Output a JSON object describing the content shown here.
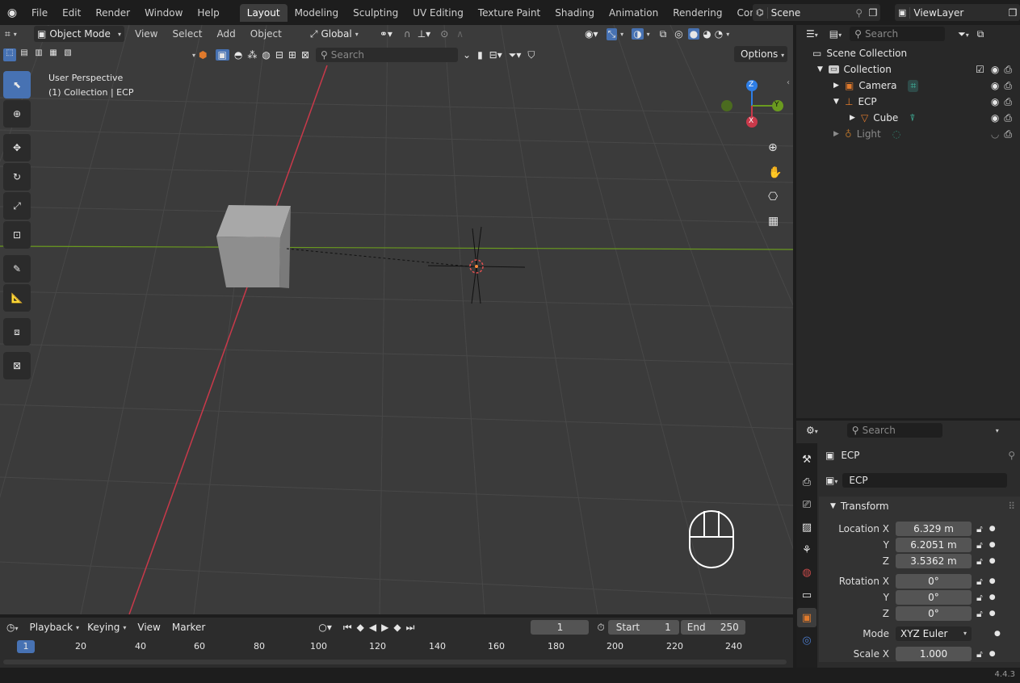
{
  "topbar": {
    "menus": [
      "File",
      "Edit",
      "Render",
      "Window",
      "Help"
    ],
    "workspaces": [
      "Layout",
      "Modeling",
      "Sculpting",
      "UV Editing",
      "Texture Paint",
      "Shading",
      "Animation",
      "Rendering",
      "Compositing"
    ],
    "scene": "Scene",
    "view_layer": "ViewLayer"
  },
  "viewport_header": {
    "mode": "Object Mode",
    "menus": [
      "View",
      "Select",
      "Add",
      "Object"
    ],
    "orientation": "Global",
    "search_placeholder": "Search",
    "options": "Options"
  },
  "viewport": {
    "perspective": "User Perspective",
    "collection_info": "(1) Collection | ECP",
    "gizmo": {
      "z": "Z",
      "y": "Y",
      "x": "X"
    }
  },
  "outliner": {
    "search_placeholder": "Search",
    "scene_collection": "Scene Collection",
    "collection": "Collection",
    "items": [
      {
        "label": "Camera"
      },
      {
        "label": "ECP"
      },
      {
        "label": "Cube"
      },
      {
        "label": "Light"
      }
    ]
  },
  "properties": {
    "search_placeholder": "Search",
    "object_name": "ECP",
    "data_name": "ECP",
    "section": "Transform",
    "location_label": "Location X",
    "loc_x": "6.329 m",
    "loc_y": "6.2051 m",
    "loc_z": "3.5362 m",
    "rotation_label": "Rotation X",
    "rot_x": "0°",
    "rot_y": "0°",
    "rot_z": "0°",
    "y_label": "Y",
    "z_label": "Z",
    "mode_label": "Mode",
    "mode_value": "XYZ Euler",
    "scale_label": "Scale X",
    "scale_x": "1.000"
  },
  "timeline": {
    "menus": [
      "Playback",
      "Keying",
      "View",
      "Marker"
    ],
    "current_frame": "1",
    "start_label": "Start",
    "start": "1",
    "end_label": "End",
    "end": "250",
    "ruler": [
      "20",
      "40",
      "60",
      "80",
      "100",
      "120",
      "140",
      "160",
      "180",
      "200",
      "220",
      "240"
    ],
    "marker": "1"
  },
  "status": {
    "version": "4.4.3"
  },
  "colors": {
    "accent": "#4772b3",
    "x_axis": "#c9394a",
    "y_axis": "#6a9a1f",
    "z_axis": "#2e7ee6"
  }
}
